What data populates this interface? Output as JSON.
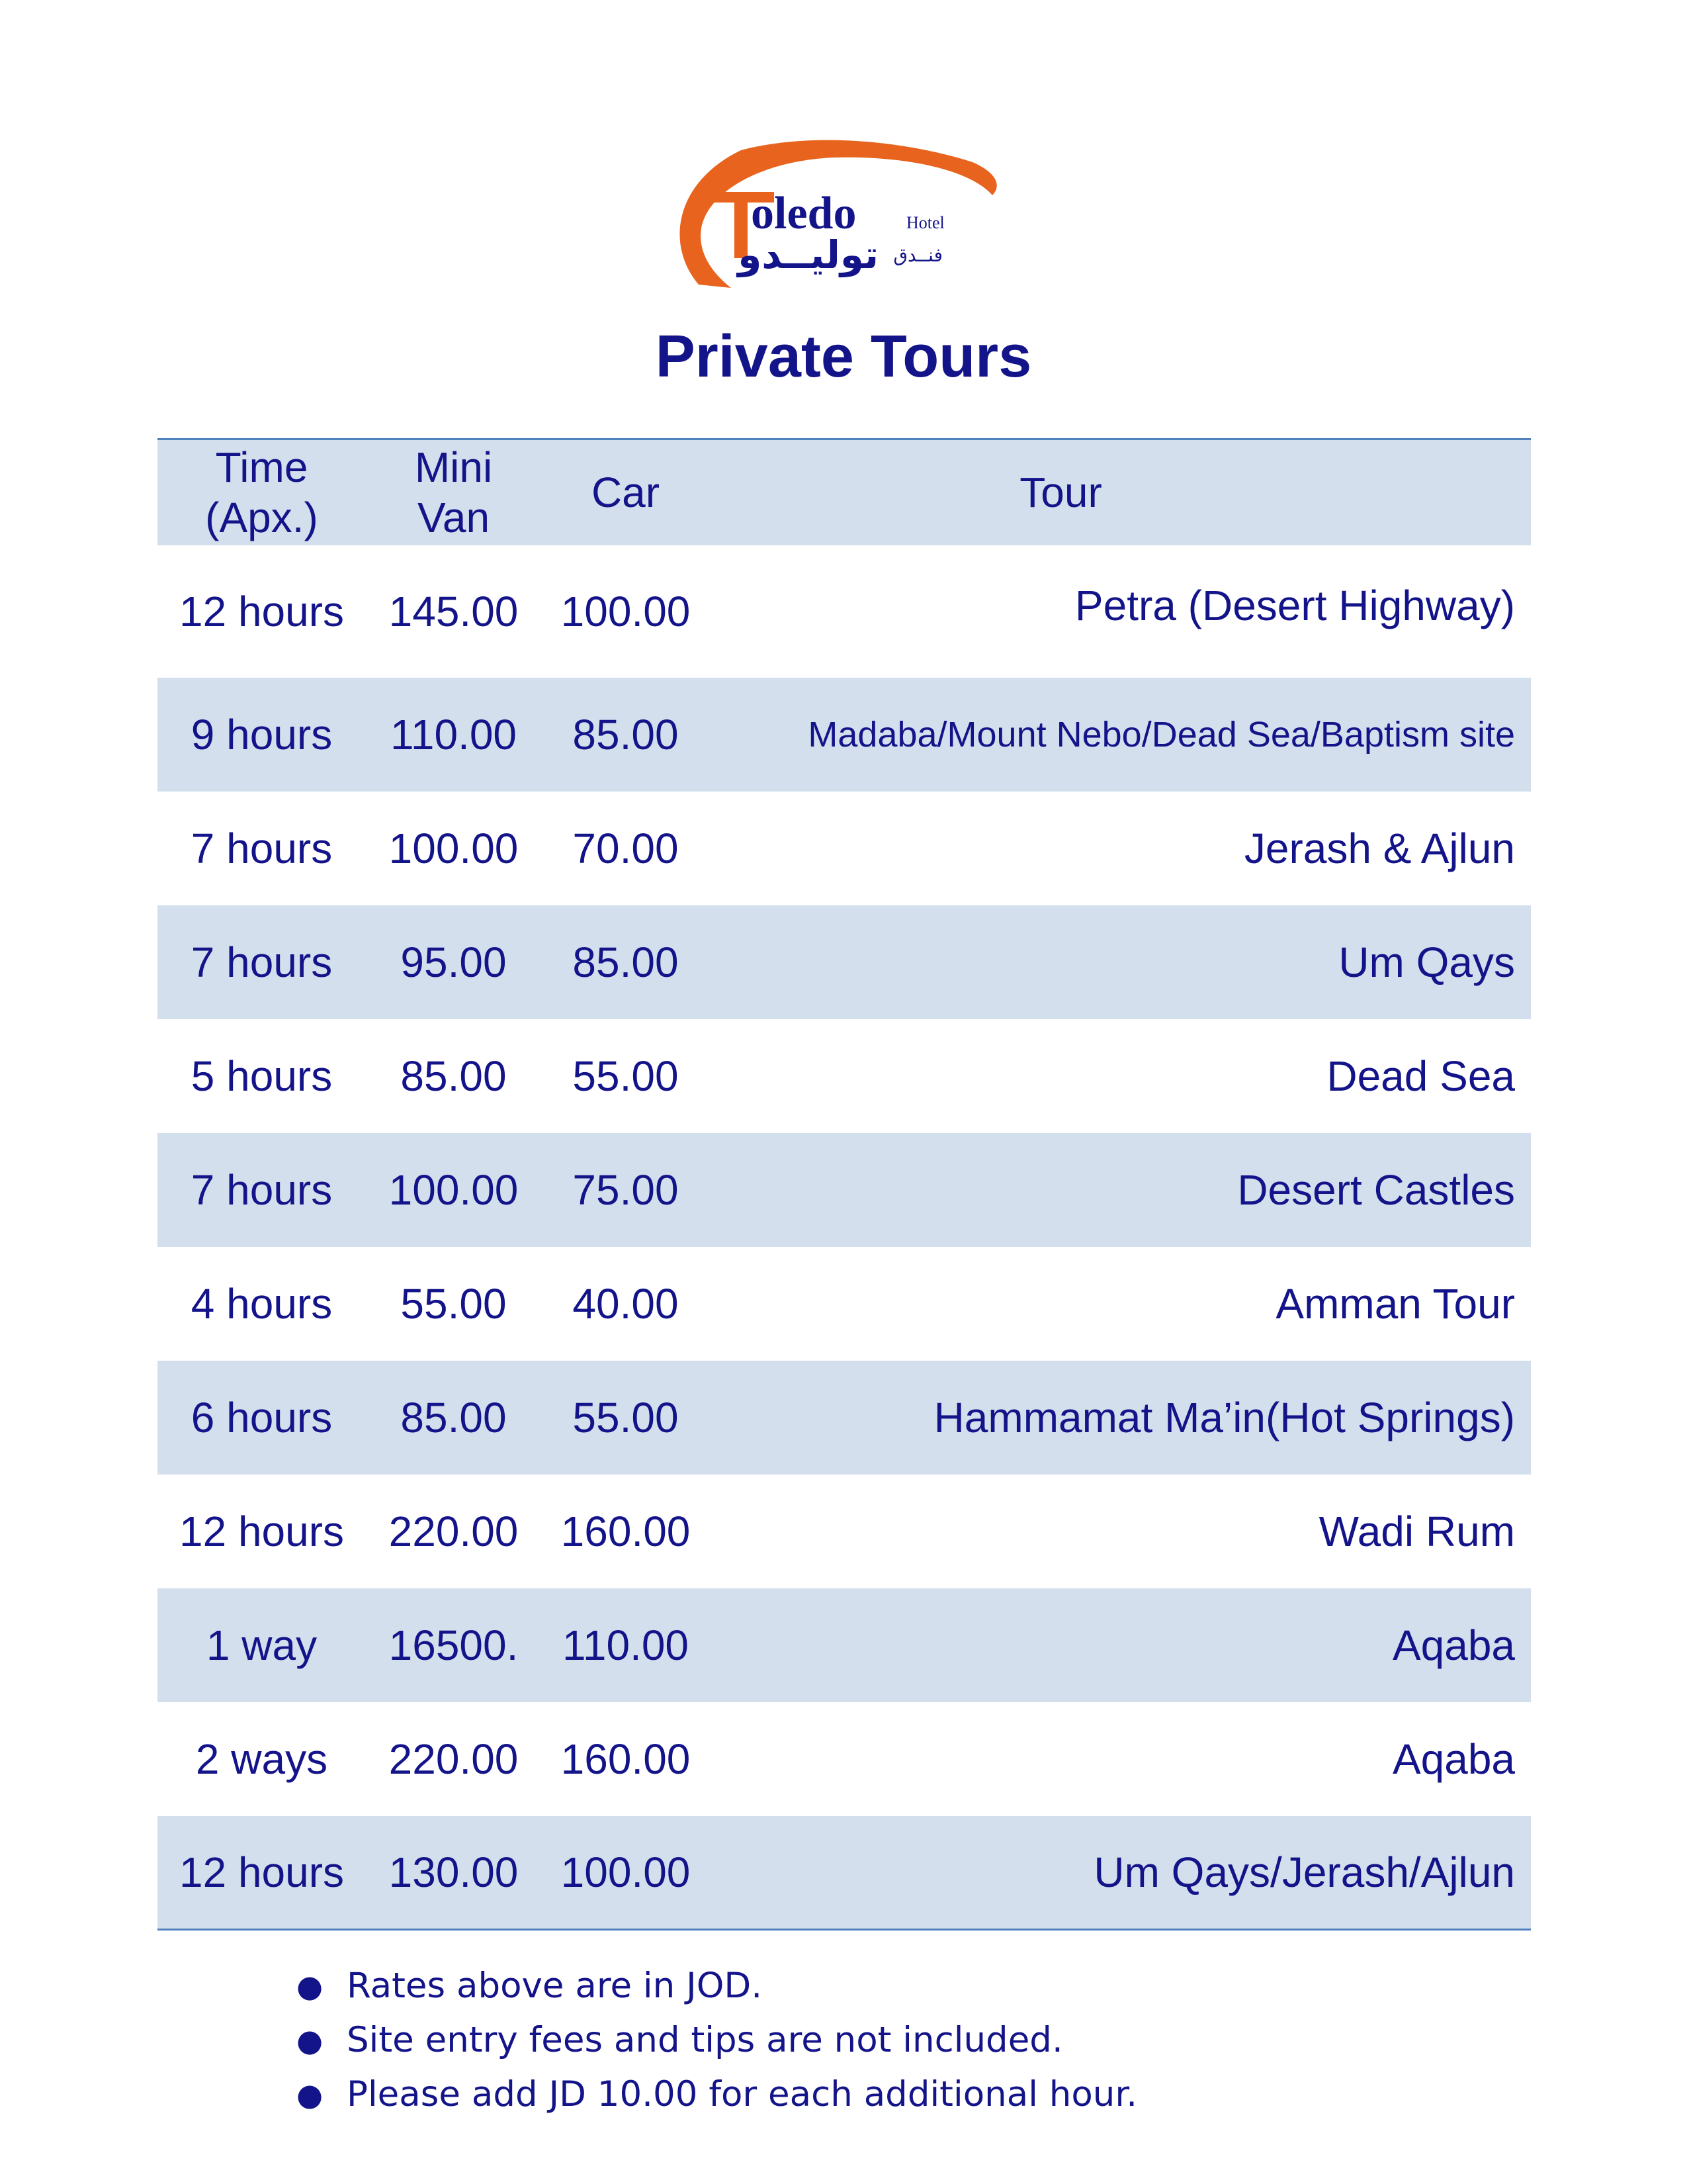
{
  "logo": {
    "wordmark": "oledo",
    "sub": "Hotel",
    "arabic_name": "توليــدو",
    "arabic_hotel": "فنــدق"
  },
  "title": "Private Tours",
  "table": {
    "headers": {
      "time_line1": "Time",
      "time_line2": "(Apx.)",
      "van_line1": "Mini",
      "van_line2": "Van",
      "car": "Car",
      "tour": "Tour"
    },
    "rows": [
      {
        "time": "12 hours",
        "van": "145.00",
        "car": "100.00",
        "tour": "Petra (Desert Highway)"
      },
      {
        "time": "9 hours",
        "van": "110.00",
        "car": "85.00",
        "tour": "Madaba/Mount Nebo/Dead Sea/Baptism site"
      },
      {
        "time": "7 hours",
        "van": "100.00",
        "car": "70.00",
        "tour": "Jerash & Ajlun"
      },
      {
        "time": "7 hours",
        "van": "95.00",
        "car": "85.00",
        "tour": "Um Qays"
      },
      {
        "time": "5 hours",
        "van": "85.00",
        "car": "55.00",
        "tour": "Dead Sea"
      },
      {
        "time": "7 hours",
        "van": "100.00",
        "car": "75.00",
        "tour": "Desert Castles"
      },
      {
        "time": "4 hours",
        "van": "55.00",
        "car": "40.00",
        "tour": "Amman Tour"
      },
      {
        "time": "6 hours",
        "van": "85.00",
        "car": "55.00",
        "tour": "Hammamat Ma’in(Hot Springs)"
      },
      {
        "time": "12 hours",
        "van": "220.00",
        "car": "160.00",
        "tour": "Wadi Rum"
      },
      {
        "time": "1 way",
        "van": "16500.",
        "car": "110.00",
        "tour": "Aqaba"
      },
      {
        "time": "2 ways",
        "van": "220.00",
        "car": "160.00",
        "tour": "Aqaba"
      },
      {
        "time": "12 hours",
        "van": "130.00",
        "car": "100.00",
        "tour": "Um Qays/Jerash/Ajlun"
      }
    ]
  },
  "notes": [
    "Rates above are in JOD.",
    "Site entry fees and tips are not included.",
    "Please add JD 10.00 for each additional hour."
  ],
  "colors": {
    "text": "#14148a",
    "band": "#d3dfec",
    "rule": "#4f81bd",
    "logo_orange": "#e8641e"
  }
}
